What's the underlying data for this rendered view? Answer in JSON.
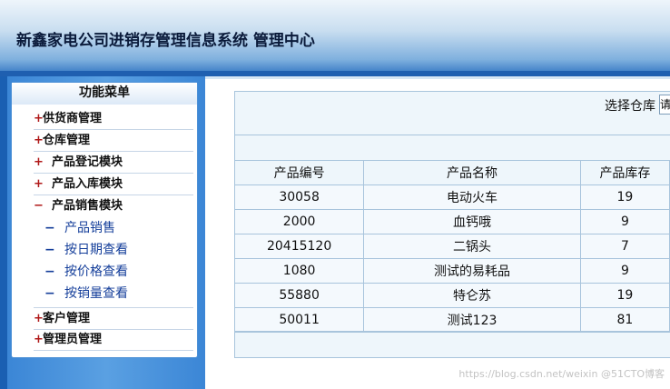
{
  "header": {
    "title": "新鑫家电公司进销存管理信息系统 管理中心"
  },
  "menu": {
    "title": "功能菜单",
    "items": [
      {
        "symbol": "+",
        "label": "供货商管理"
      },
      {
        "symbol": "+",
        "label": "仓库管理"
      },
      {
        "symbol": "+",
        "label": "产品登记模块"
      },
      {
        "symbol": "+",
        "label": "产品入库模块"
      },
      {
        "symbol": "−",
        "label": "产品销售模块"
      }
    ],
    "subitems": [
      {
        "symbol": "−",
        "label": "产品销售"
      },
      {
        "symbol": "−",
        "label": "按日期查看"
      },
      {
        "symbol": "−",
        "label": "按价格查看"
      },
      {
        "symbol": "−",
        "label": "按销量查看"
      }
    ],
    "items_after": [
      {
        "symbol": "+",
        "label": "客户管理"
      },
      {
        "symbol": "+",
        "label": "管理员管理"
      }
    ]
  },
  "filter": {
    "label": "选择仓库",
    "selected": "请"
  },
  "table": {
    "columns": [
      "产品编号",
      "产品名称",
      "产品库存"
    ],
    "rows": [
      [
        "30058",
        "电动火车",
        "19"
      ],
      [
        "2000",
        "血钙哦",
        "9"
      ],
      [
        "20415120",
        "二锅头",
        "7"
      ],
      [
        "1080",
        "测试的易耗品",
        "9"
      ],
      [
        "55880",
        "特仑苏",
        "19"
      ],
      [
        "50011",
        "测试123",
        "81"
      ]
    ]
  },
  "watermark": "https://blog.csdn.net/weixin @51CTO博客"
}
